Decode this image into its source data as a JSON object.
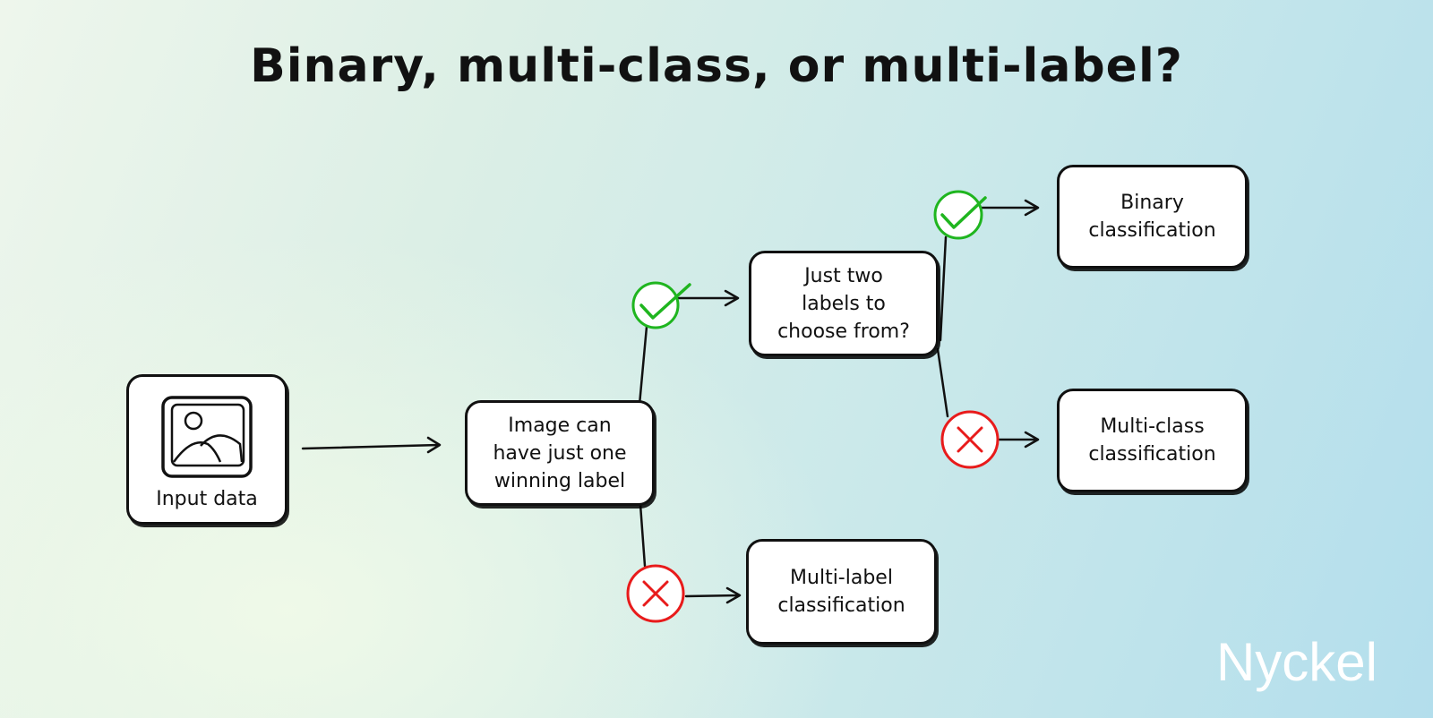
{
  "title": "Binary, multi-class, or multi-label?",
  "nodes": {
    "input": {
      "label": "Input data",
      "icon": "image-icon"
    },
    "q1": {
      "label": "Image can\nhave just one\nwinning label"
    },
    "q2": {
      "label": "Just two\nlabels to\nchoose from?"
    },
    "binary": {
      "label": "Binary\nclassification"
    },
    "multiclass": {
      "label": "Multi-class\nclassification"
    },
    "multilabel": {
      "label": "Multi-label\nclassification"
    }
  },
  "markers": {
    "yes": {
      "icon": "check-circle-icon",
      "color": "#1fb51f"
    },
    "no": {
      "icon": "x-circle-icon",
      "color": "#e81b1b"
    }
  },
  "brand": "Nyckel"
}
